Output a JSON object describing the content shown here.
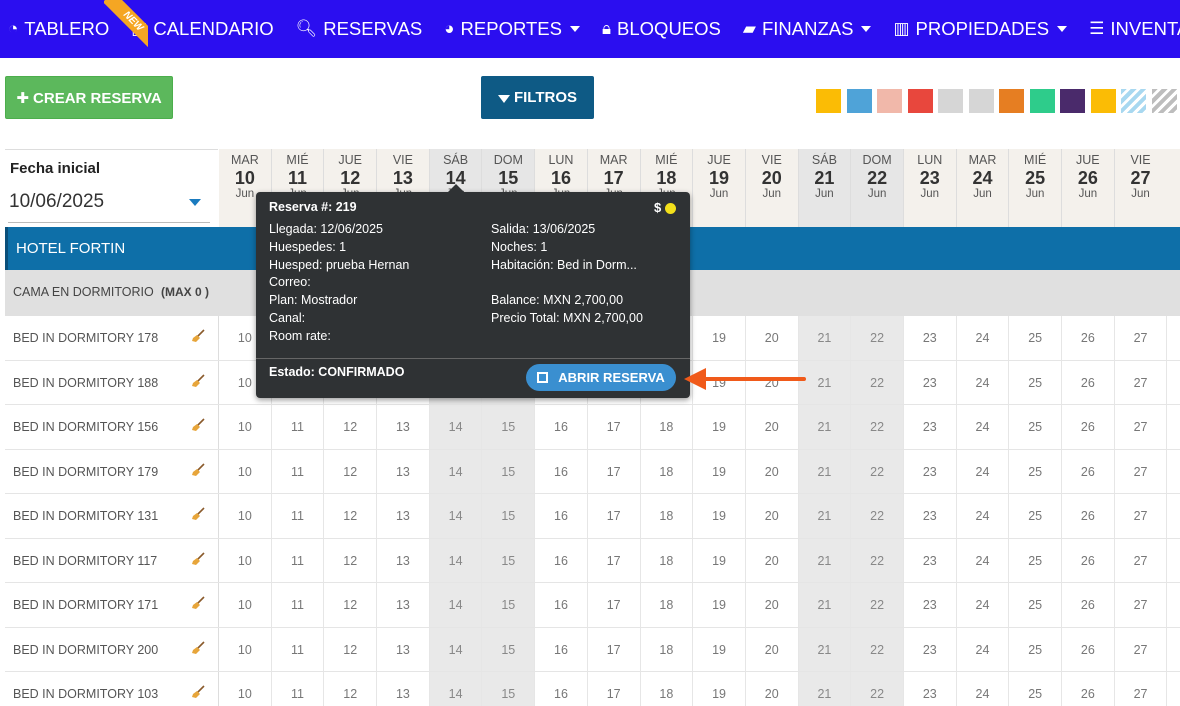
{
  "nav": {
    "items": [
      {
        "label": "TABLERO",
        "icon": "dashboard-icon",
        "glyph": "◔",
        "caret": false
      },
      {
        "label": "CALENDARIO",
        "icon": "calendar-icon",
        "glyph": "▣",
        "caret": false
      },
      {
        "label": "RESERVAS",
        "icon": "search-icon",
        "glyph": "🔍︎",
        "caret": false
      },
      {
        "label": "REPORTES",
        "icon": "pie-chart-icon",
        "glyph": "◕",
        "caret": true
      },
      {
        "label": "BLOQUEOS",
        "icon": "lock-icon",
        "glyph": "🔒︎",
        "caret": false
      },
      {
        "label": "FINANZAS",
        "icon": "folder-icon",
        "glyph": "▰",
        "caret": true
      },
      {
        "label": "PROPIEDADES",
        "icon": "map-icon",
        "glyph": "▥",
        "caret": true
      },
      {
        "label": "INVENTARIO",
        "icon": "list-icon",
        "glyph": "☰",
        "caret": true
      }
    ],
    "new_badge": "NEW"
  },
  "toolbar": {
    "create_label": "✚ CREAR RESERVA",
    "filter_label": "FILTROS",
    "swatch_colors": [
      "#fbbc05",
      "#4fa3d8",
      "#f1b8aa",
      "#e8473d",
      "#d6d6d6",
      "#d6d6d6",
      "#e67e22",
      "#2ecc8b",
      "#4a2a6b",
      "#fbbc05",
      "#a8d8f0",
      "#bdbdbd",
      "#f06292"
    ]
  },
  "calendar": {
    "date_label": "Fecha inicial",
    "date_value": "10/06/2025",
    "days": [
      {
        "dow": "MAR",
        "num": "10",
        "mon": "Jun",
        "weekend": false
      },
      {
        "dow": "MIÉ",
        "num": "11",
        "mon": "Jun",
        "weekend": false
      },
      {
        "dow": "JUE",
        "num": "12",
        "mon": "Jun",
        "weekend": false
      },
      {
        "dow": "VIE",
        "num": "13",
        "mon": "Jun",
        "weekend": false
      },
      {
        "dow": "SÁB",
        "num": "14",
        "mon": "Jun",
        "weekend": true
      },
      {
        "dow": "DOM",
        "num": "15",
        "mon": "Jun",
        "weekend": true
      },
      {
        "dow": "LUN",
        "num": "16",
        "mon": "Jun",
        "weekend": false
      },
      {
        "dow": "MAR",
        "num": "17",
        "mon": "Jun",
        "weekend": false
      },
      {
        "dow": "MIÉ",
        "num": "18",
        "mon": "Jun",
        "weekend": false
      },
      {
        "dow": "JUE",
        "num": "19",
        "mon": "Jun",
        "weekend": false
      },
      {
        "dow": "VIE",
        "num": "20",
        "mon": "Jun",
        "weekend": false
      },
      {
        "dow": "SÁB",
        "num": "21",
        "mon": "Jun",
        "weekend": true
      },
      {
        "dow": "DOM",
        "num": "22",
        "mon": "Jun",
        "weekend": true
      },
      {
        "dow": "LUN",
        "num": "23",
        "mon": "Jun",
        "weekend": false
      },
      {
        "dow": "MAR",
        "num": "24",
        "mon": "Jun",
        "weekend": false
      },
      {
        "dow": "MIÉ",
        "num": "25",
        "mon": "Jun",
        "weekend": false
      },
      {
        "dow": "JUE",
        "num": "26",
        "mon": "Jun",
        "weekend": false
      },
      {
        "dow": "VIE",
        "num": "27",
        "mon": "Jun",
        "weekend": false
      }
    ],
    "hotel_name": "HOTEL FORTIN",
    "room_type": "CAMA EN DORMITORIO",
    "room_type_max": "(MAX 0 )",
    "rooms": [
      "BED IN DORMITORY 178",
      "BED IN DORMITORY 188",
      "BED IN DORMITORY 156",
      "BED IN DORMITORY 179",
      "BED IN DORMITORY 131",
      "BED IN DORMITORY 117",
      "BED IN DORMITORY 171",
      "BED IN DORMITORY 200",
      "BED IN DORMITORY 103"
    ]
  },
  "popup": {
    "title": "Reserva #: 219",
    "currency_flag": "$",
    "left_lines": [
      "Llegada: 12/06/2025",
      "Huespedes: 1",
      "Huesped: prueba Hernan",
      "Correo:",
      "Plan: Mostrador",
      "Canal:",
      "Room rate:"
    ],
    "right_lines": [
      "Salida: 13/06/2025",
      "Noches: 1",
      "Habitación: Bed in Dorm...",
      "",
      "Balance: MXN 2,700,00",
      "Precio Total: MXN 2,700,00"
    ],
    "status": "Estado: CONFIRMADO",
    "open_label": "ABRIR RESERVA",
    "arrow_color": "#f05a1a"
  }
}
